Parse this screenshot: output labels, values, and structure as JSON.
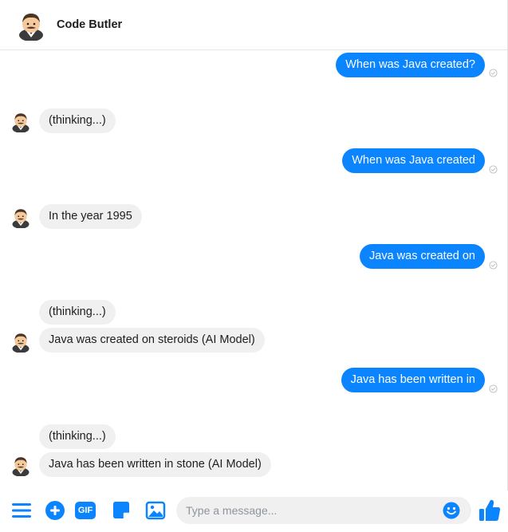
{
  "header": {
    "title": "Code Butler",
    "avatar_icon": "butler-avatar-icon"
  },
  "messages": [
    {
      "side": "out",
      "text": "When was Java created?"
    },
    {
      "side": "in",
      "text": "(thinking...)"
    },
    {
      "side": "out",
      "text": "When was Java created"
    },
    {
      "side": "in",
      "text": "In the year 1995"
    },
    {
      "side": "out",
      "text": "Java was created on"
    },
    {
      "side": "in",
      "text": "(thinking...)"
    },
    {
      "side": "in",
      "text": "Java was created on steroids (AI Model)"
    },
    {
      "side": "out",
      "text": "Java has been written in"
    },
    {
      "side": "in",
      "text": "(thinking...)"
    },
    {
      "side": "in",
      "text": "Java has been written in stone (AI Model)"
    }
  ],
  "composer": {
    "placeholder": "Type a message...",
    "gif_label": "GIF",
    "icons": [
      "menu-icon",
      "add-icon",
      "gif-icon",
      "sticker-icon",
      "image-icon",
      "emoji-icon",
      "thumbs-up-icon"
    ]
  },
  "colors": {
    "accent": "#0a84ff",
    "incoming_bubble": "#f1f0f0",
    "header_border": "#e5e5e5"
  }
}
